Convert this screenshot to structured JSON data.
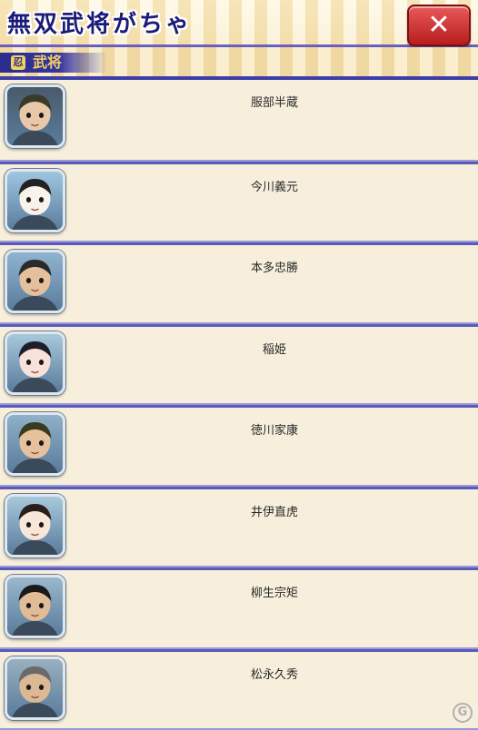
{
  "header": {
    "title": "無双武将がちゃ",
    "close_label": "✕"
  },
  "category": {
    "label": "武将"
  },
  "generals": [
    {
      "name": "服部半蔵",
      "icon": "hattori-hanzo-portrait",
      "bg": "#4a5a6a",
      "face": "#e8c8a8",
      "hair": "#3a3a2a"
    },
    {
      "name": "今川義元",
      "icon": "imagawa-yoshimoto-portrait",
      "bg": "#9fc6e0",
      "face": "#f8f2ea",
      "hair": "#222222"
    },
    {
      "name": "本多忠勝",
      "icon": "honda-tadakatsu-portrait",
      "bg": "#8fb4cf",
      "face": "#e4c09c",
      "hair": "#2a2a2a"
    },
    {
      "name": "稲姫",
      "icon": "inahime-portrait",
      "bg": "#a8c8dc",
      "face": "#f6e2d8",
      "hair": "#1e1e2a"
    },
    {
      "name": "徳川家康",
      "icon": "tokugawa-ieyasu-portrait",
      "bg": "#8fb0c8",
      "face": "#e6c29c",
      "hair": "#3a3a20"
    },
    {
      "name": "井伊直虎",
      "icon": "ii-naotora-portrait",
      "bg": "#a8c8dc",
      "face": "#f8e6d8",
      "hair": "#2a1e1a"
    },
    {
      "name": "柳生宗矩",
      "icon": "yagyu-munenori-portrait",
      "bg": "#9ab8cc",
      "face": "#e2bc96",
      "hair": "#1a1a1a"
    },
    {
      "name": "松永久秀",
      "icon": "matsunaga-hisahide-portrait",
      "bg": "#9ab0c0",
      "face": "#dcb894",
      "hair": "#6a6a6a"
    }
  ]
}
